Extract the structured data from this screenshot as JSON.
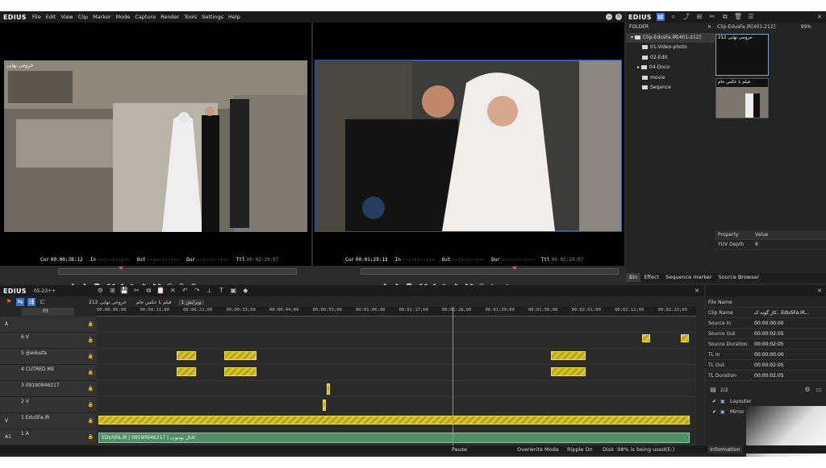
{
  "menubar": {
    "logo": "EDIUS",
    "items": [
      "File",
      "Edit",
      "View",
      "Clip",
      "Marker",
      "Mode",
      "Capture",
      "Render",
      "Tools",
      "Settings",
      "Help"
    ]
  },
  "player": {
    "title_overlay": "خروجی نهایی",
    "cur_label": "Cur",
    "cur_value": "00:00:38:12",
    "in_label": "In",
    "in_value": "--:--:--:--",
    "out_label": "Out",
    "out_value": "--:--:--:--",
    "dur_label": "Dur",
    "dur_value": "--:--:--:--",
    "ttl_label": "Ttl",
    "ttl_value": "00:02:29:07"
  },
  "recorder": {
    "cur_label": "Cur",
    "cur_value": "00:01:29:13",
    "in_label": "In",
    "in_value": "--:--:--:--",
    "out_label": "Out",
    "out_value": "--:--:--:--",
    "dur_label": "Dur",
    "dur_value": "--:--:--:--",
    "ttl_label": "Ttl",
    "ttl_value": "00:02:29:07"
  },
  "bin": {
    "logo": "EDIUS",
    "folder_label": "FOLDER",
    "clip_path": "Clip-EdusFa.iR[401-212]",
    "zoom": "99%",
    "root": "Clip-EdusFa.iR[401-212]",
    "folders": [
      "01-Video-photo",
      "02-Edit",
      "04-Doco",
      "movie",
      "Seqance"
    ],
    "thumb1_label": "خروجی نهایی 212",
    "thumb2_label": "فیلم با عکس خام",
    "props_header": [
      "Property",
      "Value"
    ],
    "props": [
      {
        "k": "YUV Depth",
        "v": "8"
      }
    ],
    "tabs": [
      "Bin",
      "Effect",
      "Sequence marker",
      "Source Browser"
    ]
  },
  "timeline": {
    "logo": "EDIUS",
    "project": "05-23++",
    "seq_tabs": [
      "خروجی نهایی 212",
      "فیلم با عکس خام",
      "ویرایش 1"
    ],
    "fit_label": "Fit",
    "ruler": [
      "00:00:00;00",
      "00:00:11;00",
      "00:00:22;00",
      "00:00:33;00",
      "00:00:44;00",
      "00:00:55;00",
      "00:01:06;00",
      "00:01:17;00",
      "00:01:28;00",
      "00:01:39;00",
      "00:01:50;00",
      "00:02:01;00",
      "00:02:12;00",
      "00:02:23;00"
    ],
    "tracks": [
      {
        "side": "A",
        "name": ""
      },
      {
        "side": "",
        "name": "6 V"
      },
      {
        "side": "",
        "name": "5 @edusfa"
      },
      {
        "side": "",
        "name": "4 CUTRED.ME"
      },
      {
        "side": "",
        "name": "3 09190946217"
      },
      {
        "side": "",
        "name": "2 V"
      },
      {
        "side": "V",
        "name": "1 EduSFa.iR"
      },
      {
        "side": "A1",
        "name": "1 A"
      }
    ],
    "audio_clip_text": "EDUSFA.iR | 09190946217 | کانال یوتیوب"
  },
  "info": {
    "rows": [
      {
        "k": "File Name",
        "v": ""
      },
      {
        "k": "Clip Name",
        "v": "کار گونه ک...EduSFa.iR..."
      },
      {
        "k": "Source In",
        "v": "00:00:00:00"
      },
      {
        "k": "Source Out",
        "v": "00:00:02:05"
      },
      {
        "k": "Source Duration",
        "v": "00:00:02:05"
      },
      {
        "k": "TL In",
        "v": "00:00:00:00"
      },
      {
        "k": "TL Out",
        "v": "00:00:02:05"
      },
      {
        "k": "TL Duration",
        "v": "00:00:02:05"
      }
    ],
    "page": "2/2",
    "filters": [
      "Layouter",
      "Mirror"
    ],
    "tab": "Information"
  },
  "status": {
    "pause": "Pause",
    "overwrite": "Overwrite Mode",
    "ripple": "Ripple On",
    "disk": "Disk :98% is being used(E:)"
  },
  "colors": {
    "accent": "#3a6fd8",
    "clip": "#d6c627",
    "audio_clip": "#4f8f68",
    "playhead": "#e05050"
  }
}
